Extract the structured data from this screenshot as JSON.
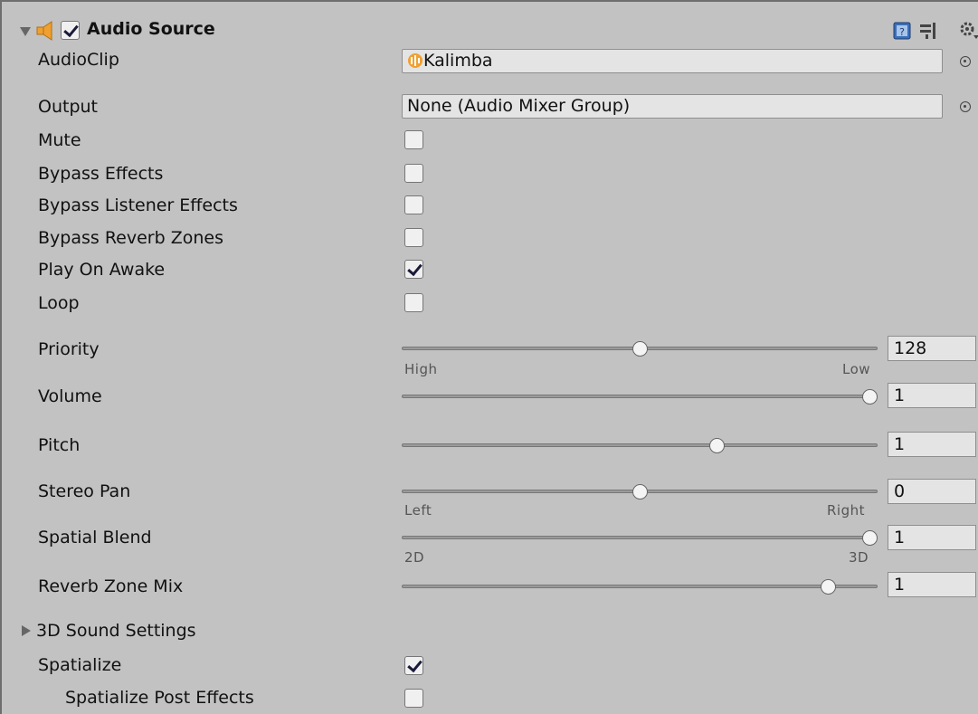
{
  "header": {
    "title": "Audio Source",
    "enabled": true,
    "icons": [
      "speaker-icon",
      "help-book-icon",
      "preset-icon",
      "gear-icon"
    ]
  },
  "audio_clip": {
    "label": "AudioClip",
    "value": "Kalimba",
    "icon": "audio-clip-icon"
  },
  "output": {
    "label": "Output",
    "value": "None (Audio Mixer Group)"
  },
  "toggles": [
    {
      "label": "Mute",
      "checked": false
    },
    {
      "label": "Bypass Effects",
      "checked": false
    },
    {
      "label": "Bypass Listener Effects",
      "checked": false
    },
    {
      "label": "Bypass Reverb Zones",
      "checked": false
    },
    {
      "label": "Play On Awake",
      "checked": true
    },
    {
      "label": "Loop",
      "checked": false
    }
  ],
  "sliders": [
    {
      "label": "Priority",
      "value": "128",
      "fraction": 0.5,
      "left_label": "High",
      "right_label": "Low"
    },
    {
      "label": "Volume",
      "value": "1",
      "fraction": 1.0
    },
    {
      "label": "Pitch",
      "value": "1",
      "fraction": 0.667
    },
    {
      "label": "Stereo Pan",
      "value": "0",
      "fraction": 0.5,
      "left_label": "Left",
      "right_label": "Right"
    },
    {
      "label": "Spatial Blend",
      "value": "1",
      "fraction": 1.0,
      "left_label": "2D",
      "right_label": "3D"
    },
    {
      "label": "Reverb Zone Mix",
      "value": "1",
      "fraction": 0.909
    }
  ],
  "sound_settings": {
    "label": "3D Sound Settings",
    "expanded": false
  },
  "spatialize": {
    "label": "Spatialize",
    "checked": true
  },
  "spatialize_post": {
    "label": "Spatialize Post Effects",
    "checked": false
  },
  "colors": {
    "panel_bg": "#c2c2c2",
    "field_bg": "#e4e4e4",
    "speaker_orange": "#f0a030",
    "help_blue": "#3a6fb8"
  }
}
